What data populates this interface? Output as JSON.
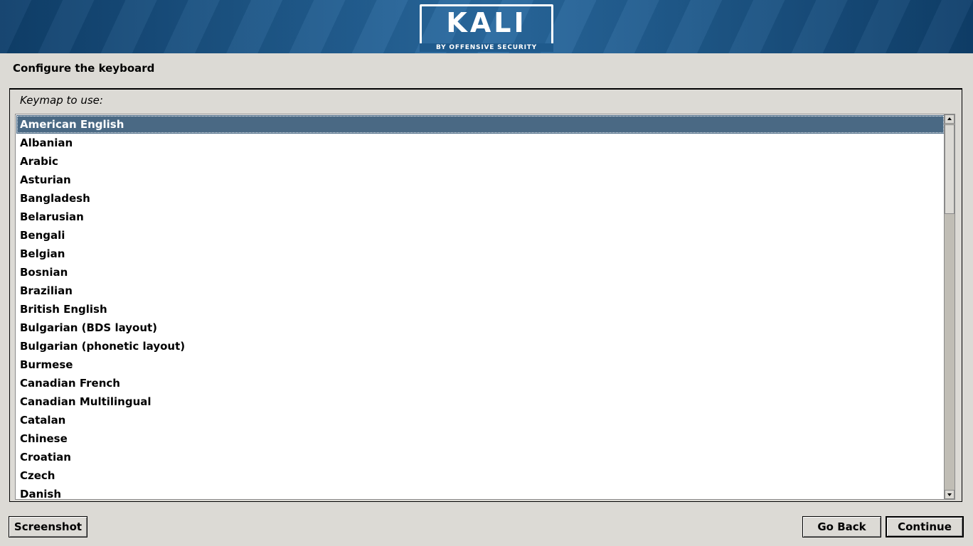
{
  "header": {
    "logo_text": "KALI",
    "logo_subtext": "BY OFFENSIVE SECURITY"
  },
  "page": {
    "title": "Configure the keyboard"
  },
  "keymap": {
    "label": "Keymap to use:",
    "selected": "American English",
    "items": [
      "American English",
      "Albanian",
      "Arabic",
      "Asturian",
      "Bangladesh",
      "Belarusian",
      "Bengali",
      "Belgian",
      "Bosnian",
      "Brazilian",
      "British English",
      "Bulgarian (BDS layout)",
      "Bulgarian (phonetic layout)",
      "Burmese",
      "Canadian French",
      "Canadian Multilingual",
      "Catalan",
      "Chinese",
      "Croatian",
      "Czech",
      "Danish"
    ]
  },
  "buttons": {
    "screenshot": "Screenshot",
    "go_back": "Go Back",
    "continue": "Continue"
  },
  "colors": {
    "selection": "#4a6984",
    "background": "#dcdad5",
    "banner": "#1f5a8c"
  }
}
